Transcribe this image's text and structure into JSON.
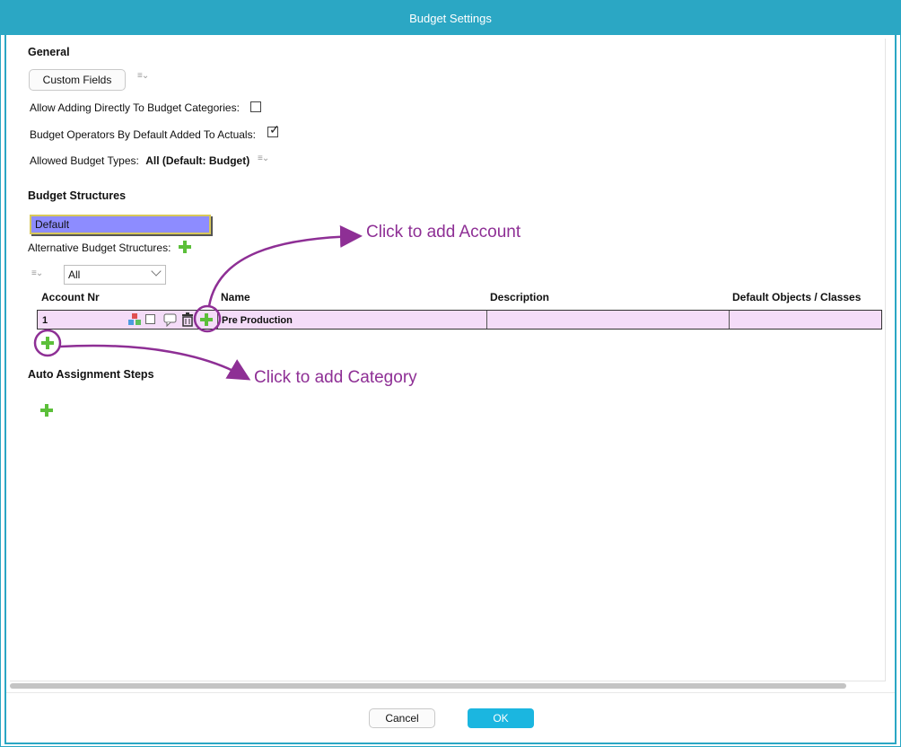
{
  "window": {
    "title": "Budget Settings"
  },
  "general": {
    "title": "General",
    "custom_fields_label": "Custom Fields",
    "allow_adding_label": "Allow Adding Directly To Budget Categories:",
    "allow_adding_checked": false,
    "operators_label": "Budget Operators By Default Added To Actuals:",
    "operators_checked": true,
    "allowed_types_label": "Allowed Budget Types:",
    "allowed_types_value": "All (Default: Budget)"
  },
  "structures": {
    "title": "Budget Structures",
    "selected": "Default",
    "alt_label": "Alternative Budget Structures:",
    "filter_value": "All",
    "columns": [
      "Account Nr",
      "Name",
      "Description",
      "Default Objects / Classes"
    ],
    "rows": [
      {
        "account_nr": "1",
        "name": "Pre Production",
        "description": "",
        "default_objects": ""
      }
    ]
  },
  "auto_assignment": {
    "title": "Auto Assignment Steps"
  },
  "annotations": {
    "add_account": "Click to add Account",
    "add_category": "Click to add Category",
    "color": "#8e2f95"
  },
  "footer": {
    "cancel_label": "Cancel",
    "ok_label": "OK"
  }
}
